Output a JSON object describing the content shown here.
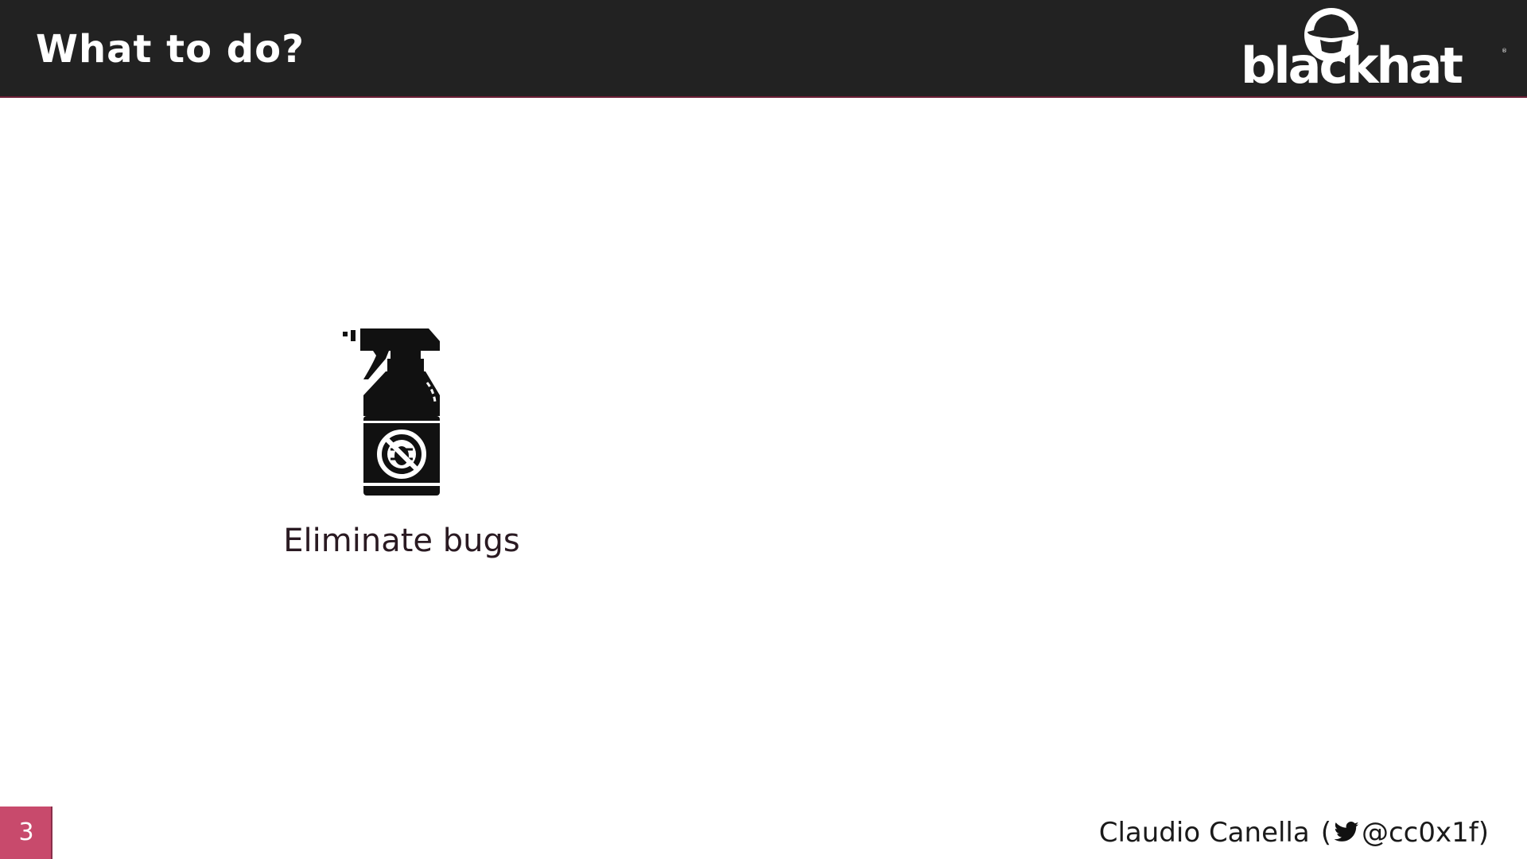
{
  "slide": {
    "title": "What to do?",
    "page_number": "3"
  },
  "logo": {
    "text": "blackhat",
    "trademark": "®",
    "icon": "hat-silhouette-icon"
  },
  "content": {
    "item_icon": "spray-bottle-no-bug-icon",
    "item_label": "Eliminate bugs"
  },
  "footer": {
    "author_name": "Claudio Canella",
    "open_paren": "(",
    "handle_icon": "twitter-bird-icon",
    "handle": "@cc0x1f",
    "close_paren": ")"
  },
  "colors": {
    "header_bg": "#222222",
    "accent": "#c84a6c",
    "text": "#1a1a1a"
  }
}
